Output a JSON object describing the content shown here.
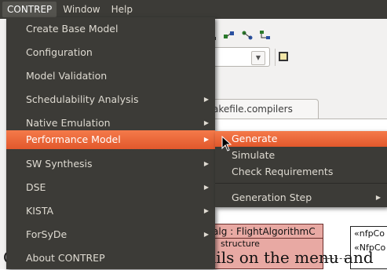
{
  "menubar": {
    "items": [
      {
        "label": "CONTREP"
      },
      {
        "label": "Window"
      },
      {
        "label": "Help"
      }
    ]
  },
  "contrep_menu": {
    "items": [
      {
        "label": "Create Base Model",
        "has_submenu": false
      },
      {
        "label": "Configuration",
        "has_submenu": false
      },
      {
        "label": "Model Validation",
        "has_submenu": false
      },
      {
        "label": "Schedulability Analysis",
        "has_submenu": true
      },
      {
        "label": "Native Emulation",
        "has_submenu": true
      },
      {
        "label": "Performance Model",
        "has_submenu": true,
        "highlighted": true
      },
      {
        "label": "SW Synthesis",
        "has_submenu": true
      },
      {
        "label": "DSE",
        "has_submenu": true
      },
      {
        "label": "KISTA",
        "has_submenu": true
      },
      {
        "label": "ForSyDe",
        "has_submenu": true
      },
      {
        "label": "About CONTREP",
        "has_submenu": false
      }
    ]
  },
  "performance_submenu": {
    "items": [
      {
        "label": "Generate",
        "highlighted": true
      },
      {
        "label": "Simulate"
      },
      {
        "label": "Check Requirements"
      },
      {
        "label": "Generation Step",
        "has_submenu": true
      }
    ]
  },
  "background": {
    "tab_label": "akefile.compilers",
    "flight_block_title": "alg : FlightAlgorithmC",
    "flight_block_compartment": "structure",
    "nfp_lines": [
      "«nfpCo",
      "«NfpCo"
    ],
    "bottom_text": "CONTREP menu (and details on the menu and"
  },
  "colors": {
    "menu_bg": "#3c3b37",
    "highlight": "#e95420",
    "menu_text": "#dfdbd2",
    "block_fill": "#e8a9a3"
  },
  "icons": {
    "submenu_arrow": "triangle-right",
    "cursor": "arrow-pointer"
  }
}
